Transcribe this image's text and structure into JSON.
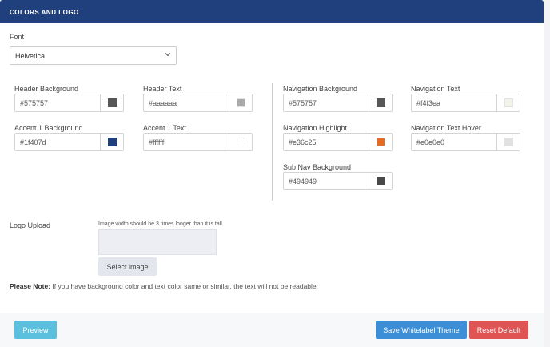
{
  "header": {
    "title": "COLORS AND LOGO"
  },
  "font": {
    "label": "Font",
    "selected": "Helvetica"
  },
  "colors": {
    "header_background": {
      "label": "Header Background",
      "value": "#575757",
      "swatch": "#575757"
    },
    "header_text": {
      "label": "Header Text",
      "value": "#aaaaaa",
      "swatch": "#aaaaaa"
    },
    "accent1_background": {
      "label": "Accent 1 Background",
      "value": "#1f407d",
      "swatch": "#1f407d"
    },
    "accent1_text": {
      "label": "Accent 1 Text",
      "value": "#ffffff",
      "swatch": "#ffffff"
    },
    "nav_background": {
      "label": "Navigation Background",
      "value": "#575757",
      "swatch": "#575757"
    },
    "nav_text": {
      "label": "Navigation Text",
      "value": "#f4f3ea",
      "swatch": "#f4f3ea"
    },
    "nav_highlight": {
      "label": "Navigation Highlight",
      "value": "#e36c25",
      "swatch": "#e36c25"
    },
    "nav_text_hover": {
      "label": "Navigation Text Hover",
      "value": "#e0e0e0",
      "swatch": "#e0e0e0"
    },
    "subnav_background": {
      "label": "Sub Nav Background",
      "value": "#494949",
      "swatch": "#494949"
    }
  },
  "logo": {
    "label": "Logo Upload",
    "hint": "Image width should be 3 times longer than it is tall.",
    "select_label": "Select image"
  },
  "note": {
    "prefix": "Please Note:",
    "text": " If you have background color and text color same or similar, the text will not be readable."
  },
  "buttons": {
    "preview": "Preview",
    "save": "Save Whitelabel Theme",
    "reset": "Reset Default"
  },
  "theme": {
    "brand": "#1f407d",
    "info": "#5bc0de",
    "primary": "#3c8fd6",
    "danger": "#e05553"
  },
  "icons": {
    "select_chevron": "chevron-down-icon"
  }
}
